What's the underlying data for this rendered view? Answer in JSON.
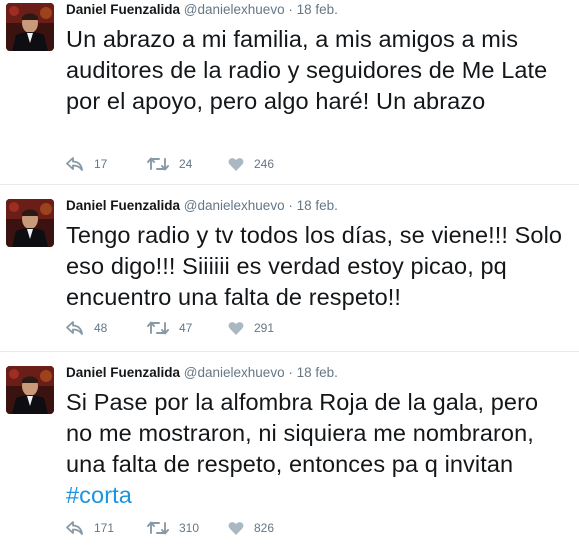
{
  "tweets": [
    {
      "author_name": "Daniel Fuenzalida",
      "handle": "@danielexhuevo",
      "separator": "·",
      "time": "18 feb.",
      "text": "Un abrazo a mi familia, a mis amigos a mis auditores de la radio y seguidores de Me Late por el apoyo, pero algo haré! Un abrazo",
      "hashtag": "",
      "replies": "17",
      "retweets": "24",
      "likes": "246"
    },
    {
      "author_name": "Daniel Fuenzalida",
      "handle": "@danielexhuevo",
      "separator": "·",
      "time": "18 feb.",
      "text": "Tengo radio y tv todos los días, se viene!!! Solo eso digo!!! Siiiiii es verdad estoy picao, pq encuentro una falta de respeto!!",
      "hashtag": "",
      "replies": "48",
      "retweets": "47",
      "likes": "291"
    },
    {
      "author_name": "Daniel Fuenzalida",
      "handle": "@danielexhuevo",
      "separator": "·",
      "time": "18 feb.",
      "text": "Si Pase por la alfombra Roja de la gala, pero no me mostraron, ni siquiera me nombraron, una falta de respeto, entonces pa q invitan",
      "hashtag": "#corta",
      "replies": "171",
      "retweets": "310",
      "likes": "826"
    }
  ],
  "icons": {
    "reply": "reply-icon",
    "retweet": "retweet-icon",
    "like": "heart-icon"
  },
  "colors": {
    "text": "#14171a",
    "muted": "#657786",
    "hashtag": "#1b95e0",
    "divider": "#e6ecf0"
  }
}
